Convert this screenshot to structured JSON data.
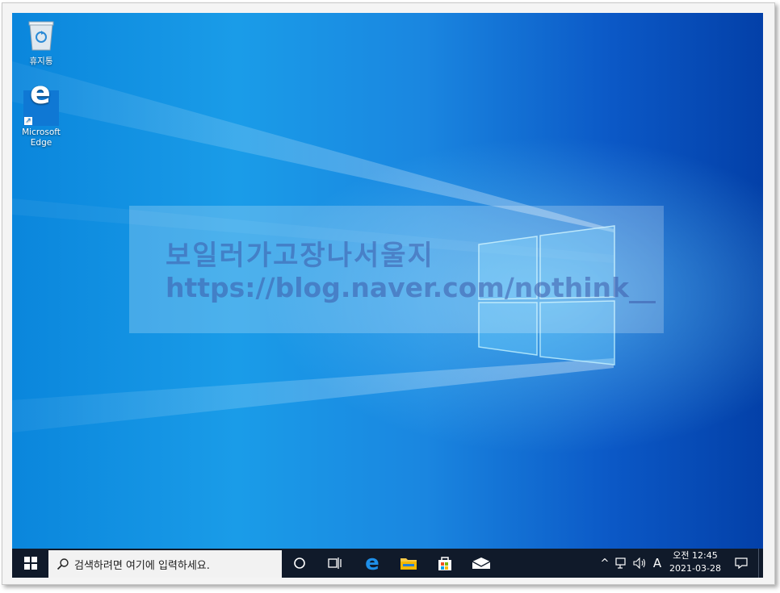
{
  "desktop": {
    "icons": [
      {
        "label": "휴지통",
        "icon": "recycle-bin-icon"
      },
      {
        "label": "Microsoft Edge",
        "label_line1": "Microsoft",
        "label_line2": "Edge",
        "icon": "edge-icon"
      }
    ],
    "watermark": {
      "line1": "보일러가고장나서울지",
      "line2": "https://blog.naver.com/nothink__"
    }
  },
  "taskbar": {
    "start_icon": "windows-start-icon",
    "search": {
      "icon": "search-icon",
      "placeholder": "검색하려면 여기에 입력하세요."
    },
    "apps": [
      {
        "name": "cortana",
        "icon": "cortana-circle-icon"
      },
      {
        "name": "task-view",
        "icon": "task-view-icon"
      },
      {
        "name": "edge",
        "icon": "edge-icon"
      },
      {
        "name": "file-explorer",
        "icon": "folder-icon"
      },
      {
        "name": "store",
        "icon": "store-bag-icon"
      },
      {
        "name": "mail",
        "icon": "mail-icon"
      }
    ],
    "tray": {
      "chevron": "^",
      "ime": "A",
      "time": "오전 12:45",
      "date": "2021-03-28"
    },
    "colors": {
      "taskbar": "#101a2a",
      "wallpaper_accent": "#1a9ce8"
    }
  }
}
